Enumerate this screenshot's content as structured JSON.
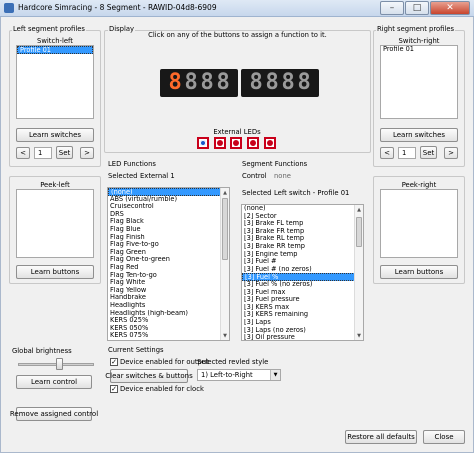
{
  "window": {
    "title": "Hardcore Simracing - 8 Segment - RAWID-04d8-6909",
    "minimize": "–",
    "maximize": "□",
    "close": "✕"
  },
  "left": {
    "profiles_title": "Left segment profiles",
    "switch_title": "Switch-left",
    "profiles": [
      "Profile 01"
    ],
    "learn_switches": "Learn switches",
    "prev": "<",
    "page": "1",
    "set": "Set",
    "next": ">",
    "peek_title": "Peek-left",
    "learn_buttons": "Learn buttons"
  },
  "right": {
    "profiles_title": "Right segment profiles",
    "switch_title": "Switch-right",
    "profiles": [
      "Profile 01"
    ],
    "learn_switches": "Learn switches",
    "prev": "<",
    "page": "1",
    "set": "Set",
    "next": ">",
    "peek_title": "Peek-right",
    "learn_buttons": "Learn buttons"
  },
  "display": {
    "title": "Display",
    "instruction": "Click on any of the buttons to assign a function to it.",
    "left_digits": [
      "8",
      "8",
      "8",
      "8"
    ],
    "right_digits": [
      "8",
      "8",
      "8",
      "8"
    ],
    "external_leds_label": "External LEDs",
    "led_count": 5
  },
  "led_functions": {
    "title": "LED Functions",
    "selected_label": "Selected",
    "selected_value": "External 1",
    "items": [
      "(none)",
      "ABS (virtual/rumble)",
      "Cruisecontrol",
      "DRS",
      "Flag Black",
      "Flag Blue",
      "Flag Finish",
      "Flag Five-to-go",
      "Flag Green",
      "Flag One-to-green",
      "Flag Red",
      "Flag Ten-to-go",
      "Flag White",
      "Flag Yellow",
      "Handbrake",
      "Headlights",
      "Headlights (high-beam)",
      "KERS 025%",
      "KERS 050%",
      "KERS 075%"
    ],
    "selected_index": 0
  },
  "segment_functions": {
    "title": "Segment Functions",
    "control_label": "Control",
    "control_value": "none",
    "selected_label": "Selected",
    "selected_value": "Left switch - Profile 01",
    "items": [
      "(none)",
      "[2] Sector",
      "[3] Brake FL temp",
      "[3] Brake FR temp",
      "[3] Brake RL temp",
      "[3] Brake RR temp",
      "[3] Engine temp",
      "[3] Fuel #",
      "[3] Fuel # (no zeros)",
      "[3] Fuel %",
      "[3] Fuel % (no zeros)",
      "[3] Fuel max",
      "[3] Fuel pressure",
      "[3] KERS max",
      "[3] KERS remaining",
      "[3] Laps",
      "[3] Laps (no zeros)",
      "[3] Oil pressure"
    ],
    "selected_index": 9
  },
  "global_brightness": {
    "title": "Global brightness",
    "learn_control": "Learn control",
    "level": 0.55
  },
  "current_settings": {
    "title": "Current Settings",
    "device_output": "Device enabled for output",
    "device_output_checked": true,
    "clear_button": "Clear switches & buttons",
    "device_clock": "Device enabled for clock",
    "device_clock_checked": true,
    "revled_label": "Selected revled style",
    "revled_value": "1) Left-to-Right"
  },
  "remove_assigned": "Remove assigned control",
  "restore_defaults": "Restore all defaults",
  "close": "Close"
}
